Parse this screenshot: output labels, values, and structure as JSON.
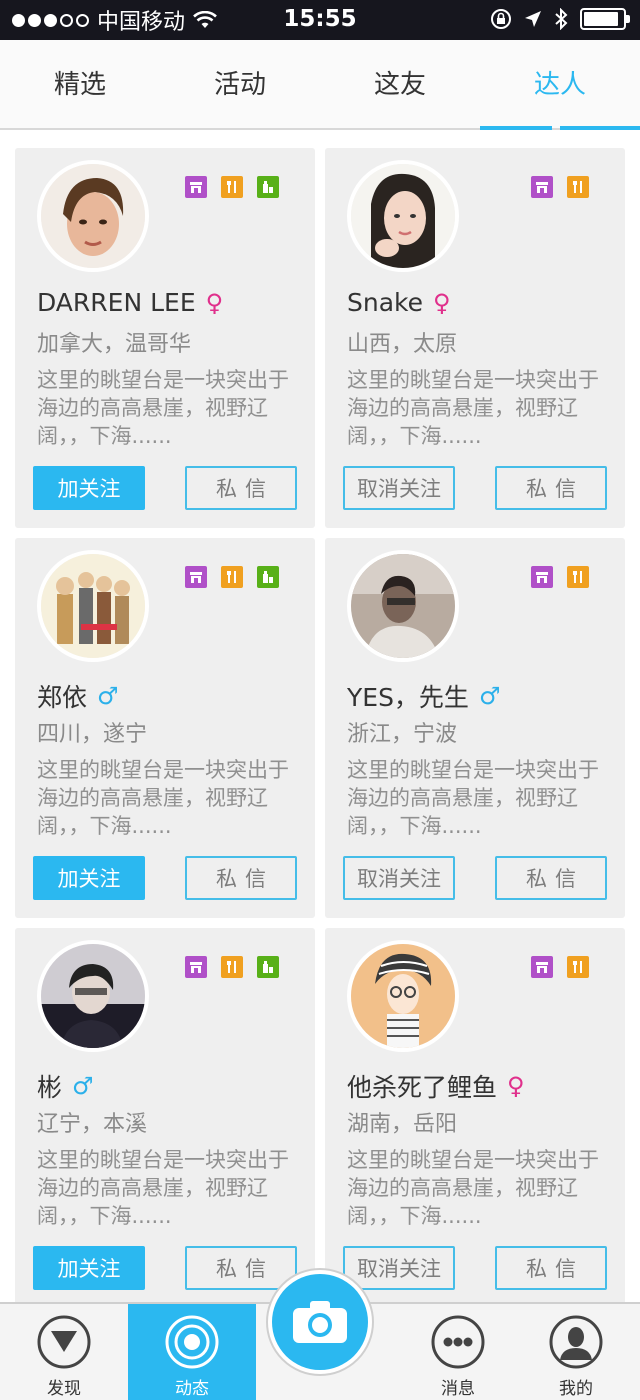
{
  "status": {
    "carrier": "中国移动",
    "time": "15:55",
    "battery_level": 0.9
  },
  "tabs": [
    {
      "label": "精选",
      "active": false
    },
    {
      "label": "活动",
      "active": false
    },
    {
      "label": "这友",
      "active": false
    },
    {
      "label": "达人",
      "active": true
    }
  ],
  "cards": [
    {
      "name": "DARREN LEE",
      "gender": "female",
      "gender_symbol": "♀",
      "location": "加拿大，温哥华",
      "desc": "这里的眺望台是一块突出于海边的高高悬崖，视野辽阔，，下海......",
      "follow_label": "加关注",
      "followed": false,
      "message_label": "私信",
      "badges": [
        "shop-icon",
        "food-icon",
        "drink-icon"
      ]
    },
    {
      "name": "Snake",
      "gender": "female",
      "gender_symbol": "♀",
      "location": "山西，太原",
      "desc": "这里的眺望台是一块突出于海边的高高悬崖，视野辽阔，，下海......",
      "follow_label": "取消关注",
      "followed": true,
      "message_label": "私信",
      "badges": [
        "shop-icon",
        "food-icon"
      ]
    },
    {
      "name": "郑依",
      "gender": "male",
      "gender_symbol": "♂",
      "location": "四川，遂宁",
      "desc": "这里的眺望台是一块突出于海边的高高悬崖，视野辽阔，，下海......",
      "follow_label": "加关注",
      "followed": false,
      "message_label": "私信",
      "badges": [
        "shop-icon",
        "food-icon",
        "drink-icon"
      ]
    },
    {
      "name": "YES，先生",
      "gender": "male",
      "gender_symbol": "♂",
      "location": "浙江，宁波",
      "desc": "这里的眺望台是一块突出于海边的高高悬崖，视野辽阔，，下海......",
      "follow_label": "取消关注",
      "followed": true,
      "message_label": "私信",
      "badges": [
        "shop-icon",
        "food-icon"
      ]
    },
    {
      "name": "彬",
      "gender": "male",
      "gender_symbol": "♂",
      "location": "辽宁，本溪",
      "desc": "这里的眺望台是一块突出于海边的高高悬崖，视野辽阔，，下海......",
      "follow_label": "加关注",
      "followed": false,
      "message_label": "私信",
      "badges": [
        "shop-icon",
        "food-icon",
        "drink-icon"
      ]
    },
    {
      "name": "他杀死了鲤鱼",
      "gender": "female",
      "gender_symbol": "♀",
      "location": "湖南，岳阳",
      "desc": "这里的眺望台是一块突出于海边的高高悬崖，视野辽阔，，下海......",
      "follow_label": "取消关注",
      "followed": true,
      "message_label": "私信",
      "badges": [
        "shop-icon",
        "food-icon"
      ]
    }
  ],
  "bottom_nav": [
    {
      "label": "发现",
      "icon": "compass-icon",
      "active": false
    },
    {
      "label": "动态",
      "icon": "activity-icon",
      "active": true
    },
    {
      "label": "消息",
      "icon": "message-icon",
      "active": false
    },
    {
      "label": "我的",
      "icon": "profile-icon",
      "active": false
    }
  ],
  "colors": {
    "accent": "#2bb8f0",
    "female": "#e0308c",
    "male": "#2bb0ea",
    "shop": "#b050c8",
    "food": "#f0a020",
    "drink": "#58b018"
  }
}
